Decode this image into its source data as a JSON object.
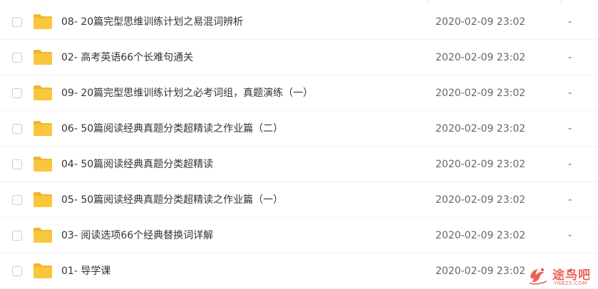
{
  "file_list": {
    "rows": [
      {
        "name": "08- 20篇完型思维训练计划之易混词辨析",
        "modified": "2020-02-09 23:02",
        "size": "-"
      },
      {
        "name": "02- 高考英语66个长难句通关",
        "modified": "2020-02-09 23:02",
        "size": "-"
      },
      {
        "name": "09- 20篇完型思维训练计划之必考词组，真题演练（一）",
        "modified": "2020-02-09 23:02",
        "size": "-"
      },
      {
        "name": "06- 50篇阅读经典真题分类超精读之作业篇（二）",
        "modified": "2020-02-09 23:02",
        "size": "-"
      },
      {
        "name": "04- 50篇阅读经典真题分类超精读",
        "modified": "2020-02-09 23:02",
        "size": "-"
      },
      {
        "name": "05- 50篇阅读经典真题分类超精读之作业篇（一）",
        "modified": "2020-02-09 23:02",
        "size": "-"
      },
      {
        "name": "03- 阅读选项66个经典替换词详解",
        "modified": "2020-02-09 23:02",
        "size": "-"
      },
      {
        "name": "01- 导学课",
        "modified": "2020-02-09 23:02",
        "size": "-"
      }
    ]
  },
  "watermark": {
    "text": "途鸟吧",
    "subtext": "YNBZS.COM"
  },
  "colors": {
    "folder": "#f9c73d",
    "folder_back": "#f2b52a",
    "watermark": "#e8473b"
  },
  "icons": {
    "row_icon": "folder-icon",
    "watermark_icon": "bird-logo-icon"
  }
}
